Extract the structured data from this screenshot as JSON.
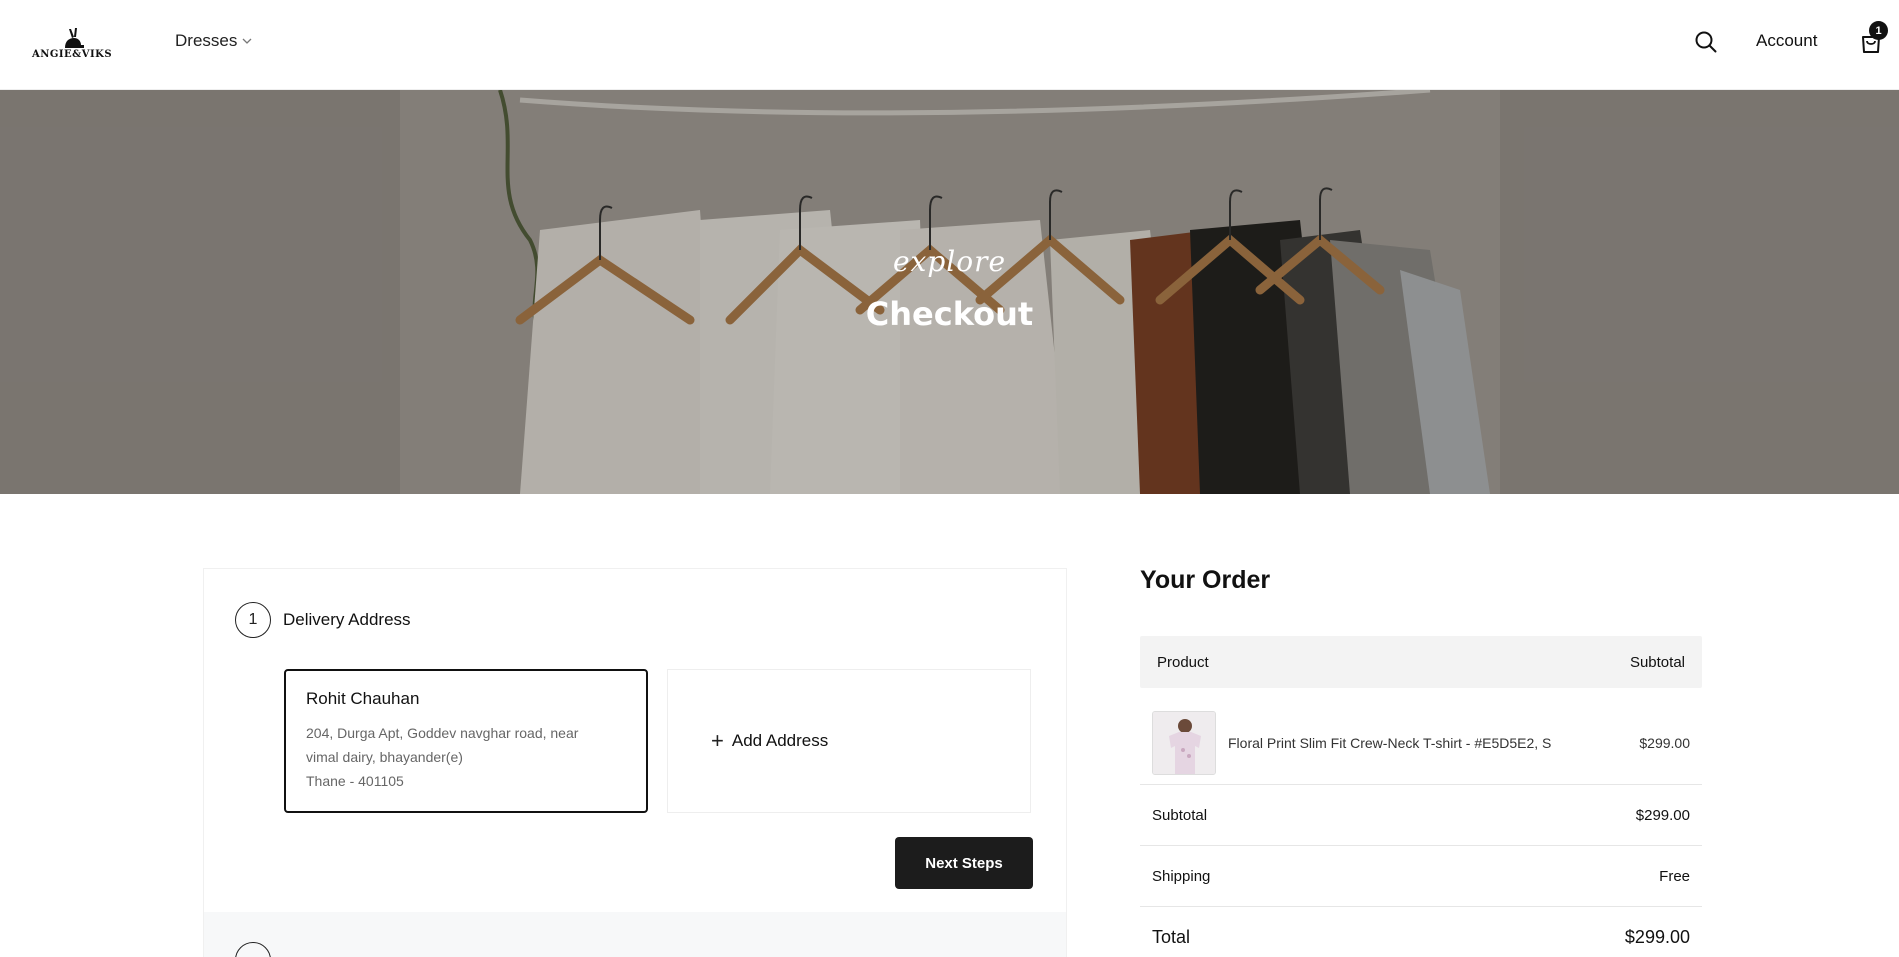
{
  "header": {
    "logo_text": "ANGIE&VIKS",
    "nav_dresses": "Dresses",
    "account_label": "Account",
    "cart_count": "1",
    "icons": [
      "search-icon",
      "cart-icon",
      "chevron-down-icon"
    ]
  },
  "hero": {
    "subtitle": "explore",
    "title": "Checkout"
  },
  "checkout": {
    "step1_number": "1",
    "step1_title": "Delivery Address",
    "address": {
      "name": "Rohit Chauhan",
      "line1": "204, Durga Apt, Goddev navghar road, near",
      "line2": "vimal dairy, bhayander(e)",
      "line3": "Thane - 401105"
    },
    "add_address_label": "Add Address",
    "next_button": "Next Steps"
  },
  "order": {
    "title": "Your Order",
    "col_product": "Product",
    "col_subtotal": "Subtotal",
    "items": [
      {
        "name": "Floral Print Slim Fit Crew-Neck T-shirt - #E5D5E2, S",
        "price": "$299.00"
      }
    ],
    "subtotal_label": "Subtotal",
    "subtotal_value": "$299.00",
    "shipping_label": "Shipping",
    "shipping_value": "Free",
    "total_label": "Total",
    "total_value": "$299.00"
  },
  "colors": {
    "accent": "#1c1c1c",
    "swatch": "#E5D5E2"
  }
}
